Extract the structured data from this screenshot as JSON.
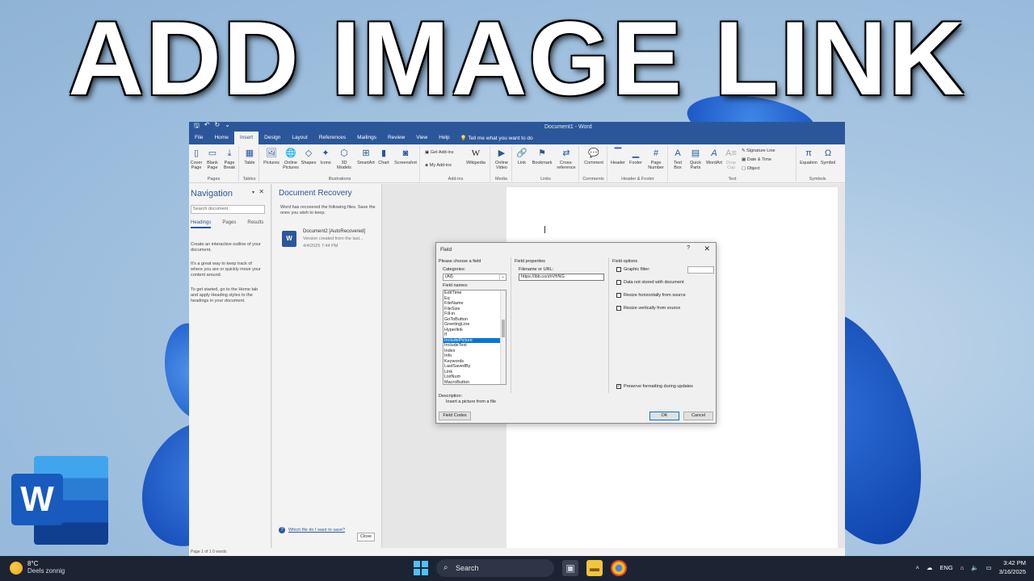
{
  "headline": "ADD IMAGE LINK",
  "word": {
    "doc_title": "Document1 - Word",
    "menu_tabs": [
      "File",
      "Home",
      "Insert",
      "Design",
      "Layout",
      "References",
      "Mailings",
      "Review",
      "View",
      "Help"
    ],
    "tell_me": "Tell me what you want to do",
    "ribbon": {
      "pages": {
        "cover": "Cover Page",
        "blank": "Blank Page",
        "break": "Page Break",
        "group": "Pages"
      },
      "tables": {
        "table": "Table",
        "group": "Tables"
      },
      "illustrations": {
        "pictures": "Pictures",
        "online": "Online Pictures",
        "shapes": "Shapes",
        "icons": "Icons",
        "models": "3D Models",
        "smartart": "SmartArt",
        "chart": "Chart",
        "screenshot": "Screenshot",
        "group": "Illustrations"
      },
      "addins": {
        "get": "Get Add-ins",
        "my": "My Add-ins",
        "wikipedia": "Wikipedia",
        "group": "Add-ins"
      },
      "media": {
        "video": "Online Video",
        "group": "Media"
      },
      "links": {
        "link": "Link",
        "bookmark": "Bookmark",
        "cross": "Cross-reference",
        "group": "Links"
      },
      "comments": {
        "comment": "Comment",
        "group": "Comments"
      },
      "headerfooter": {
        "header": "Header",
        "footer": "Footer",
        "pagenum": "Page Number",
        "group": "Header & Footer"
      },
      "text": {
        "textbox": "Text Box",
        "quick": "Quick Parts",
        "wordart": "WordArt",
        "dropcap": "Drop Cap",
        "sig": "Signature Line",
        "date": "Date & Time",
        "object": "Object",
        "group": "Text"
      },
      "symbols": {
        "equation": "Equation",
        "symbol": "Symbol",
        "group": "Symbols"
      }
    },
    "nav": {
      "title": "Navigation",
      "search_placeholder": "Search document",
      "tabs": [
        "Headings",
        "Pages",
        "Results"
      ],
      "p1": "Create an interactive outline of your document.",
      "p2": "It's a great way to keep track of where you are or quickly move your content around.",
      "p3": "To get started, go to the Home tab and apply Heading styles to the headings in your document."
    },
    "recovery": {
      "title": "Document Recovery",
      "subtitle": "Word has recovered the following files. Save the ones you wish to keep.",
      "doc_name": "Document2 [AutoRecovered]",
      "doc_sub": "Version created from the last...",
      "doc_date": "4/4/2025 7:44 PM",
      "help_link": "Which file do I want to save?",
      "close": "Close"
    },
    "status": "Page 1 of 1     0 words"
  },
  "dialog": {
    "title": "Field",
    "help": "?",
    "choose": "Please choose a field",
    "categories_label": "Categories:",
    "category_value": "(All)",
    "field_names_label": "Field names:",
    "field_names": [
      "EditTime",
      "Eq",
      "FileName",
      "FileSize",
      "Fill-in",
      "GoToButton",
      "GreetingLine",
      "Hyperlink",
      "If",
      "IncludePicture",
      "IncludeText",
      "Index",
      "Info",
      "Keywords",
      "LastSavedBy",
      "Link",
      "ListNum",
      "MacroButton"
    ],
    "selected_field": "IncludePicture",
    "props_title": "Field properties",
    "filename_label": "Filename or URL:",
    "filename_value": "https://ibb.co/zhVfrNG",
    "options_title": "Field options",
    "opt_graphic": "Graphic filter:",
    "opt_data": "Data not stored with document",
    "opt_horiz": "Resize horizontally from source",
    "opt_vert": "Resize vertically from source",
    "opt_preserve": "Preserve formatting during updates",
    "description_label": "Description:",
    "description": "Insert a picture from a file",
    "field_codes": "Field Codes",
    "ok": "OK",
    "cancel": "Cancel"
  },
  "logo_letter": "W",
  "taskbar": {
    "temp": "8°C",
    "weather": "Deels zonnig",
    "search": "Search",
    "lang": "ENG",
    "time": "3:42 PM",
    "date": "3/16/2025"
  },
  "colors": {
    "word_blue": "#2b579a",
    "select_blue": "#0078d7",
    "taskbar": "#1c2433"
  }
}
